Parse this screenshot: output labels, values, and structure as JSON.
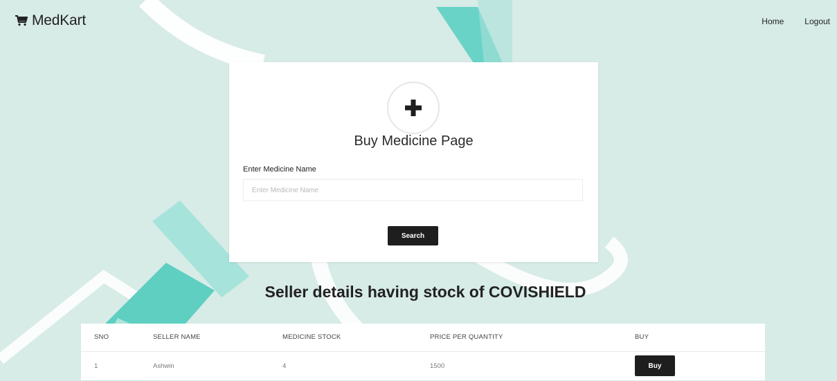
{
  "navbar": {
    "brand": "MedKart",
    "brand_icon": "cart-icon",
    "links": [
      "Home",
      "Logout"
    ]
  },
  "card": {
    "icon": "plus-icon",
    "title": "Buy Medicine Page",
    "field_label": "Enter Medicine Name",
    "field_placeholder": "Enter Medicine Name",
    "field_value": "",
    "search_label": "Search"
  },
  "section": {
    "heading": "Seller details having stock of COVISHIELD"
  },
  "table": {
    "headers": [
      "SNO",
      "SELLER NAME",
      "MEDICINE STOCK",
      "PRICE PER QUANTITY",
      "BUY"
    ],
    "rows": [
      {
        "sno": "1",
        "seller": "Ashwin",
        "stock": "4",
        "price": "1500",
        "buy_label": "Buy"
      }
    ]
  },
  "colors": {
    "background": "#d7ebe7",
    "accent_teal": "#5ecfc1",
    "accent_light": "#a6e3da",
    "button": "#1e1e1e"
  }
}
